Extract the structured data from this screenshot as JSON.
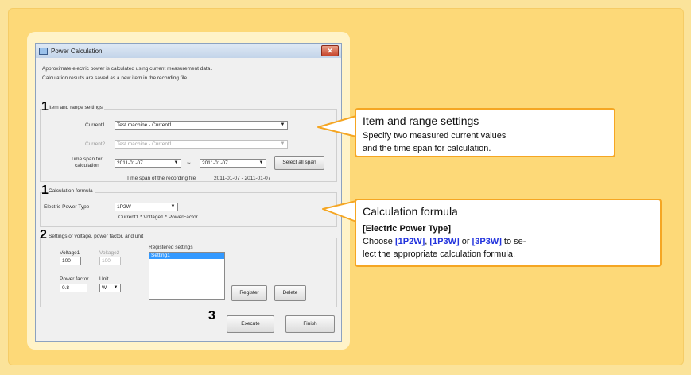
{
  "dialog": {
    "title": "Power Calculation",
    "desc_line1": "Approximate electric power is calculated using current measurement data.",
    "desc_line2": "Calculation results are saved as a new item in the recording file.",
    "close_glyph": "✕"
  },
  "item_range": {
    "step": "1",
    "group_title": "Item and range settings",
    "current1_label": "Current1",
    "current1_value": "Test machine - Current1",
    "current2_label": "Current2",
    "current2_value": "Test machine - Current1",
    "timespan_label_line1": "Time span for",
    "timespan_label_line2": "calculation",
    "start_date": "2011-01-07",
    "tilde": "~",
    "end_date": "2011-01-07",
    "select_all_span": "Select all span",
    "recording_span_label": "Time span of the recording file",
    "recording_span_value": "2011-01-07 - 2011-01-07"
  },
  "formula": {
    "step": "1",
    "group_title": "Calculation formula",
    "type_label": "Electric Power Type",
    "type_value": "1P2W",
    "formula_text": "Current1 * Voltage1 * PowerFactor"
  },
  "settings": {
    "step": "2",
    "group_title": "Settings of voltage, power factor, and unit",
    "voltage1_label": "Voltage1",
    "voltage1_value": "100",
    "voltage2_label": "Voltage2",
    "voltage2_value": "100",
    "pf_label": "Power factor",
    "pf_value": "0.8",
    "unit_label": "Unit",
    "unit_value": "W",
    "registered_label": "Registered settings",
    "registered_items": [
      "Setting1"
    ],
    "register_button": "Register",
    "delete_button": "Delete"
  },
  "footer": {
    "step": "3",
    "execute_button": "Execute",
    "finish_button": "Finish"
  },
  "callout1": {
    "title": "Item and range settings",
    "line1": "Specify two measured current values",
    "line2": "and the time span for calculation."
  },
  "callout2": {
    "title": "Calculation formula",
    "subtitle": "[Electric Power Type]",
    "l1_a": "Choose ",
    "l1_b": "[1P2W]",
    "l1_c": ", ",
    "l1_d": "[1P3W]",
    "l1_e": " or ",
    "l1_f": "[3P3W]",
    "l1_g": " to se-",
    "line2": "lect the appropriate calculation formula."
  },
  "colors": {
    "background": "#fbe39a",
    "panel": "#fdd978",
    "callout_border": "#f5a623",
    "keyword_blue": "#2233dd"
  }
}
